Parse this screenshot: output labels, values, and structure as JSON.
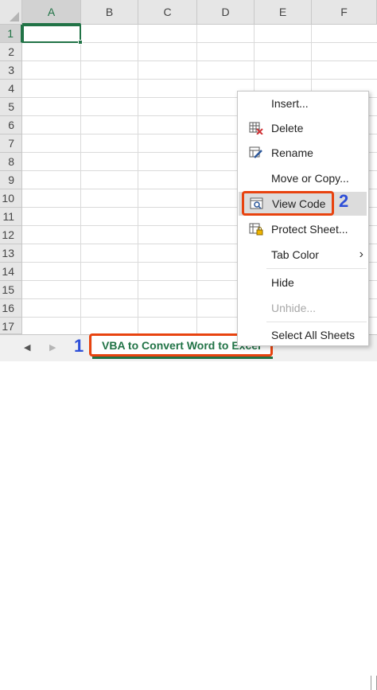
{
  "columns": [
    "A",
    "B",
    "C",
    "D",
    "E",
    "F"
  ],
  "rows": [
    "1",
    "2",
    "3",
    "4",
    "5",
    "6",
    "7",
    "8",
    "9",
    "10",
    "11",
    "12",
    "13",
    "14",
    "15",
    "16",
    "17"
  ],
  "selection": {
    "cell": "A1",
    "column": "A",
    "row": "1"
  },
  "sheet_tabs": {
    "prev_arrow": "◀",
    "next_arrow": "▶",
    "active_tab": "VBA to Convert Word to Excel"
  },
  "context_menu": {
    "items": [
      {
        "label": "Insert...",
        "icon": "none",
        "enabled": true
      },
      {
        "label": "Delete",
        "icon": "delete-sheet-icon",
        "enabled": true
      },
      {
        "label": "Rename",
        "icon": "rename-sheet-icon",
        "enabled": true
      },
      {
        "label": "Move or Copy...",
        "icon": "none",
        "enabled": true
      },
      {
        "label": "View Code",
        "icon": "view-code-icon",
        "enabled": true,
        "highlighted": true
      },
      {
        "label": "Protect Sheet...",
        "icon": "protect-sheet-icon",
        "enabled": true
      },
      {
        "label": "Tab Color",
        "icon": "none",
        "enabled": true,
        "submenu": true
      },
      {
        "label": "Hide",
        "icon": "none",
        "enabled": true
      },
      {
        "label": "Unhide...",
        "icon": "none",
        "enabled": false
      },
      {
        "label": "Select All Sheets",
        "icon": "none",
        "enabled": true
      }
    ],
    "submenu_arrow": "›"
  },
  "annotations": {
    "step1": "1",
    "step2": "2"
  },
  "colors": {
    "excel_green": "#217346",
    "highlight_box": "#e8430f",
    "step_number": "#2e4fd8",
    "menu_highlight": "#dcdcdc"
  }
}
